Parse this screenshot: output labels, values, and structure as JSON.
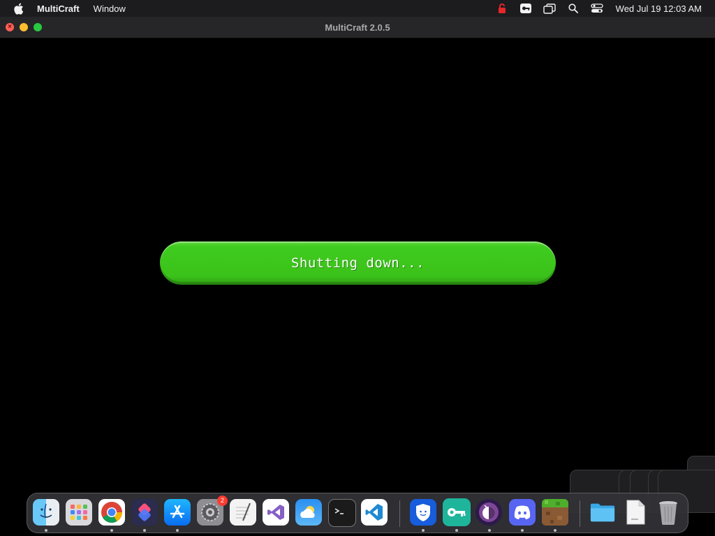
{
  "menubar": {
    "app_name": "MultiCraft",
    "menus": [
      "Window"
    ],
    "clock": "Wed Jul 19  12:03 AM",
    "status_icons": [
      "lock-icon",
      "key-icon",
      "window-icon",
      "search-icon",
      "control-center-icon"
    ],
    "lock_color": "#e5262a"
  },
  "window": {
    "title": "MultiCraft 2.0.5"
  },
  "main": {
    "status_text": "Shutting down...",
    "pill_color": "#3fc71e"
  },
  "dock": {
    "apps": [
      {
        "name": "finder-icon",
        "running": true
      },
      {
        "name": "launchpad-icon",
        "running": false
      },
      {
        "name": "chrome-icon",
        "running": true
      },
      {
        "name": "shortcuts-icon",
        "running": true
      },
      {
        "name": "app-store-icon",
        "running": true
      },
      {
        "name": "system-settings-icon",
        "running": false,
        "badge": "2"
      },
      {
        "name": "textedit-icon",
        "running": false
      },
      {
        "name": "visual-studio-icon",
        "running": false
      },
      {
        "name": "weather-icon",
        "running": false
      },
      {
        "name": "terminal-icon",
        "running": false
      },
      {
        "name": "vscode-icon",
        "running": false
      },
      {
        "name": "bitwarden-icon",
        "running": true
      },
      {
        "name": "key-app-icon",
        "running": true
      },
      {
        "name": "tor-browser-icon",
        "running": true
      },
      {
        "name": "discord-icon",
        "running": true
      },
      {
        "name": "multicraft-icon",
        "running": true
      },
      {
        "name": "folder-icon",
        "running": false
      },
      {
        "name": "document-icon",
        "running": false
      },
      {
        "name": "trash-icon",
        "running": false
      }
    ],
    "system_settings_badge": "2"
  }
}
